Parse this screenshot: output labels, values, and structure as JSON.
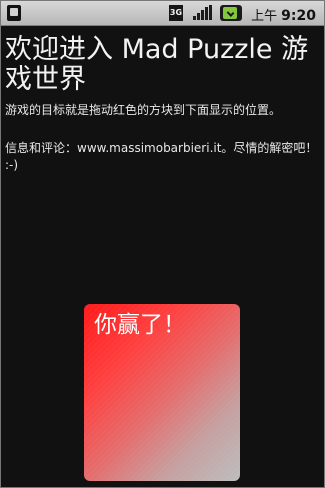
{
  "status_bar": {
    "sd_icon": "sd-card-icon",
    "network_badge": "3G",
    "signal_icon": "signal-strength-icon",
    "battery_icon": "battery-charging-icon",
    "ampm": "上午",
    "time": "9:20"
  },
  "page": {
    "title": "欢迎进入 Mad Puzzle 游戏世界",
    "description": "游戏的目标就是拖动红色的方块到下面显示的位置。",
    "reviews": "信息和评论：www.massimobarbieri.it。尽情的解密吧！ :-)",
    "win_message": "你赢了！"
  },
  "colors": {
    "background": "#111111",
    "status_bar": "#c9c9c9",
    "piece_red": "#ff1b1b",
    "piece_fade": "#bdbdbd",
    "battery": "#84c93d"
  }
}
